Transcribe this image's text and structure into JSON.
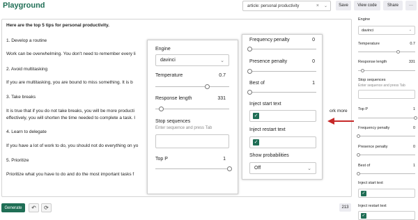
{
  "header": {
    "title": "Playground",
    "preset_value": "article: personal productivity",
    "save": "Save",
    "view_code": "View code",
    "share": "Share",
    "more": "···",
    "clear_icon": "×",
    "chevron": "⌄"
  },
  "editor": {
    "lines": [
      "Here are the top 5 tips for personal productivity.",
      "1. Develop a routine",
      "Work can be overwhelming. You don't need to remember every li",
      "2. Avoid multitasking",
      "If you are multitasking, you are bound to miss something. It is b",
      "3. Take breaks",
      "It is true that if you do not take breaks, you will be more producti",
      "effectively, you will shorten the time needed to complete a task. I",
      "4. Learn to delegate",
      "If you have a lot of work to do, you should not do everything on yo",
      "5. Prioritize",
      "Prioritize what you have to do and do the most important tasks f"
    ],
    "overflow_right": "ork more"
  },
  "footer": {
    "generate": "Generate",
    "undo_icon": "↶",
    "regen_icon": "⟳",
    "token_count": "213"
  },
  "sidebar": {
    "engine_label": "Engine",
    "engine_value": "davinci",
    "temperature_label": "Temperature",
    "temperature_value": "0.7",
    "temperature_level": 0.7,
    "response_length_label": "Response length",
    "response_length_value": "331",
    "response_length_level": 0.08,
    "stop_label": "Stop sequences",
    "stop_hint": "Enter sequence and press Tab",
    "top_p_label": "Top P",
    "top_p_value": "1",
    "top_p_level": 1.0,
    "freq_label": "Frequency penalty",
    "freq_value": "0",
    "presence_label": "Presence penalty",
    "presence_value": "0",
    "best_of_label": "Best of",
    "best_of_value": "1",
    "inject_start_label": "Inject start text",
    "inject_restart_label": "Inject restart text",
    "check": "✓"
  },
  "zoom_left": {
    "engine_label": "Engine",
    "engine_value": "davinci",
    "temperature_label": "Temperature",
    "temperature_value": "0.7",
    "response_length_label": "Response length",
    "response_length_value": "331",
    "stop_label": "Stop sequences",
    "stop_hint": "Enter sequence and press Tab",
    "top_p_label": "Top P",
    "top_p_value": "1"
  },
  "zoom_right": {
    "freq_label": "Frequency penalty",
    "freq_value": "0",
    "presence_label": "Presence penalty",
    "presence_value": "0",
    "best_of_label": "Best of",
    "best_of_value": "1",
    "inject_start_label": "Inject start text",
    "inject_restart_label": "Inject restart text",
    "show_prob_label": "Show probabilities",
    "show_prob_value": "Off"
  },
  "colors": {
    "brand": "#1f6e55",
    "arrow": "#c62828"
  }
}
